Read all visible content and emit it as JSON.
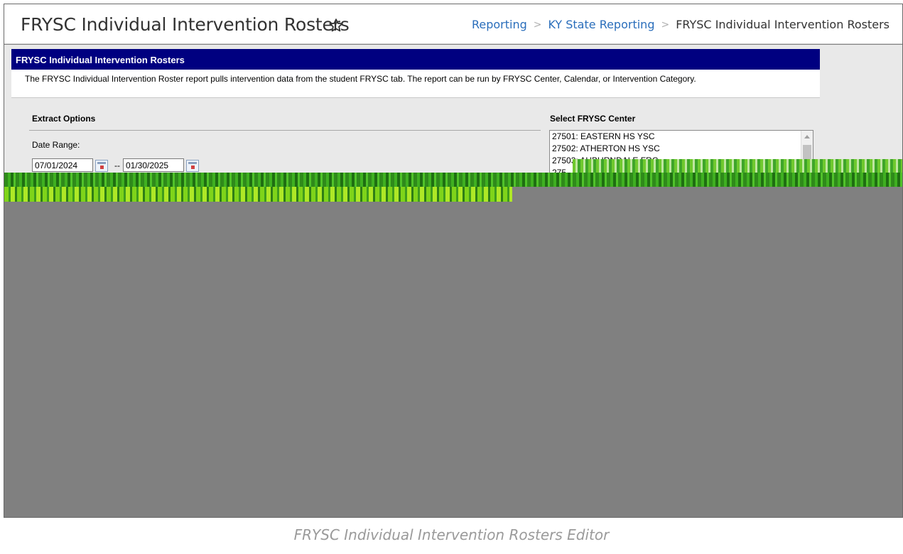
{
  "header": {
    "title": "FRYSC Individual Intervention Rosters",
    "breadcrumb": [
      {
        "label": "Reporting"
      },
      {
        "label": "KY State Reporting"
      },
      {
        "label": "FRYSC Individual Intervention Rosters"
      }
    ],
    "breadcrumb_separator": ">"
  },
  "tool": {
    "section_title": "FRYSC Individual Intervention Rosters",
    "description": "The FRYSC Individual Intervention Roster report pulls intervention data from the student FRYSC tab. The report can be run by FRYSC Center, Calendar, or Intervention Category."
  },
  "extract_options": {
    "title": "Extract Options",
    "date_range_label": "Date Range:",
    "start_date": "07/01/2024",
    "range_separator": "--",
    "end_date": "01/30/2025"
  },
  "frysc_center": {
    "title": "Select FRYSC Center",
    "options": [
      "27501: EASTERN HS YSC",
      "27502: ATHERTON HS YSC",
      "27503: AUBURNDALE FRC",
      "275"
    ]
  },
  "caption": "FRYSC Individual Intervention Rosters Editor",
  "colors": {
    "section_header_bg": "#000080",
    "link": "#2a6ebb",
    "workspace_bg": "#e9e9e9",
    "frame_bg": "#808080"
  }
}
